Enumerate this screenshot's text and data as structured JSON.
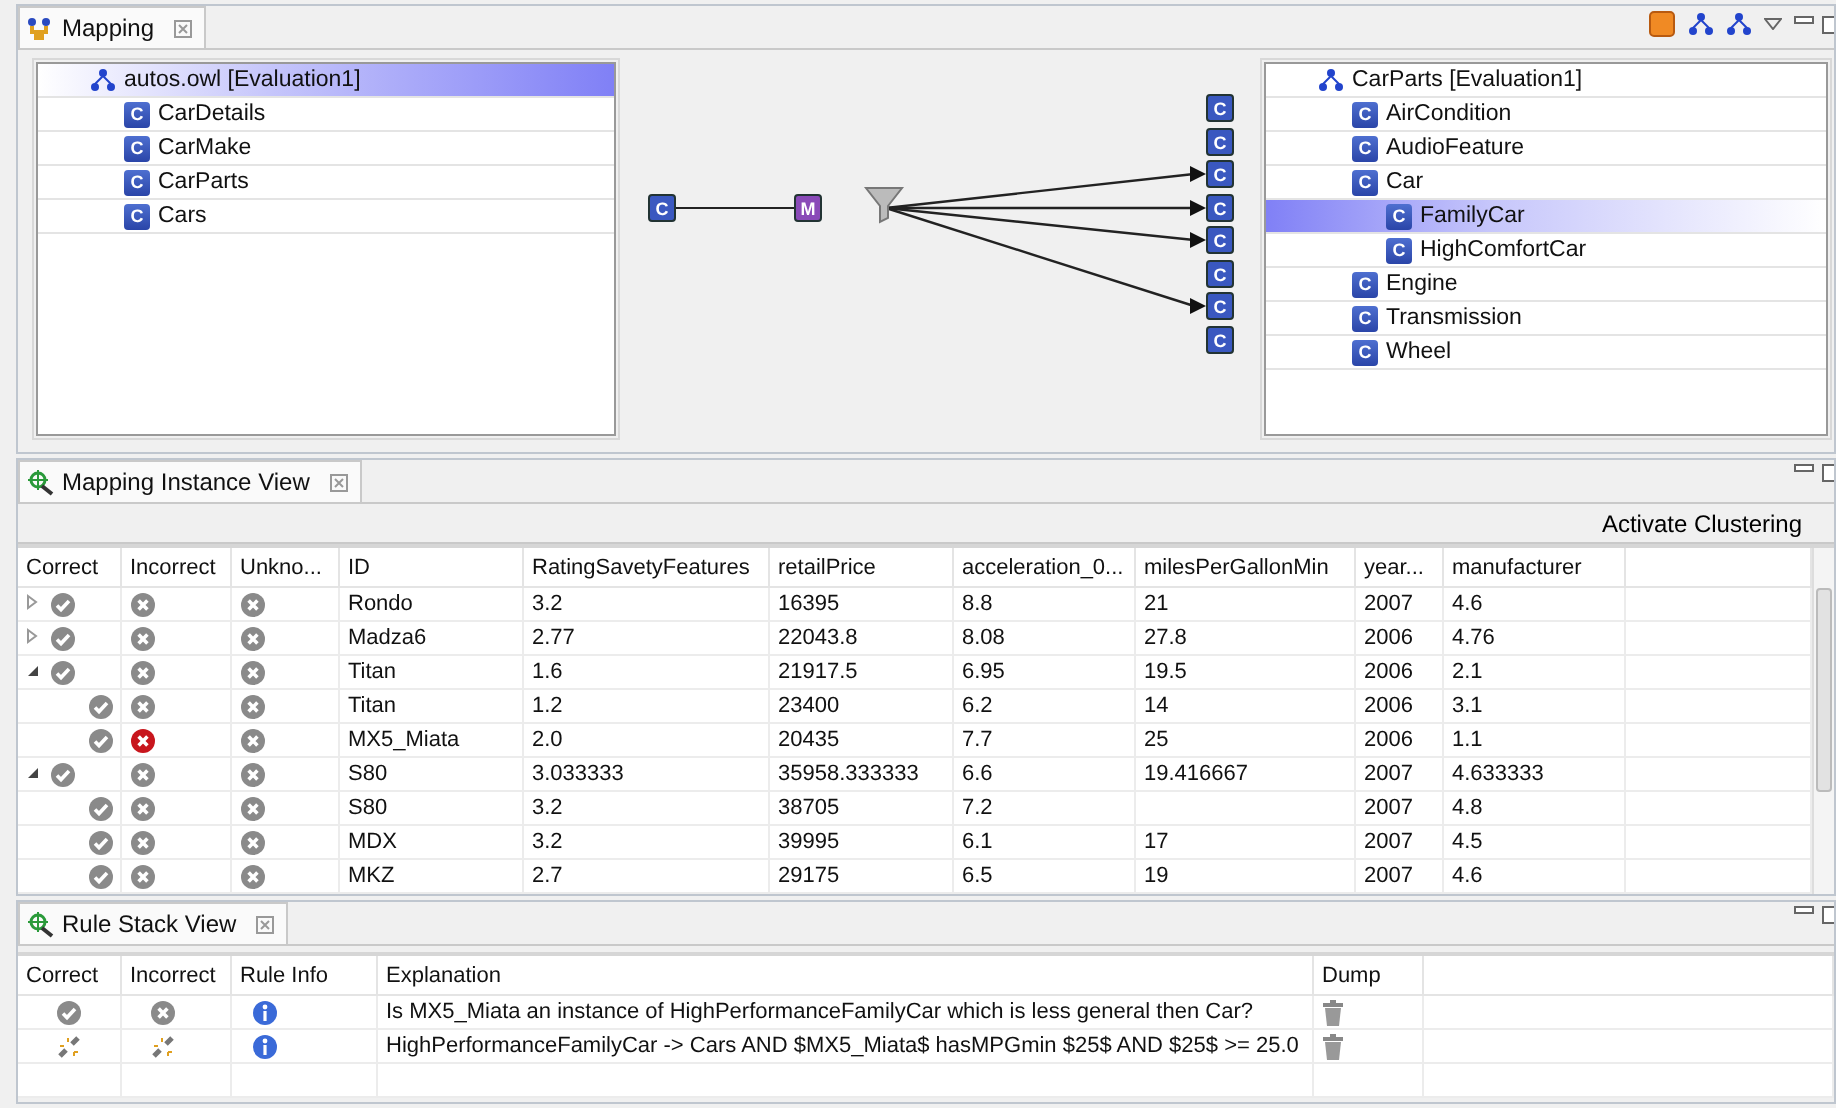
{
  "mapping": {
    "tab": "Mapping",
    "source_tree": {
      "label": "autos.owl [Evaluation1]",
      "kind": "ontology",
      "selected": true,
      "children": [
        {
          "label": "CarDetails",
          "kind": "class",
          "icon_letter": "C",
          "selected": false
        },
        {
          "label": "CarMake",
          "kind": "class",
          "icon_letter": "C",
          "selected": false
        },
        {
          "label": "CarParts",
          "kind": "class",
          "icon_letter": "C",
          "selected": false
        },
        {
          "label": "Cars",
          "kind": "class",
          "icon_letter": "C",
          "selected": false
        }
      ]
    },
    "diagram": {
      "source_node": {
        "label": "C"
      },
      "mapping_node": {
        "label": "M"
      },
      "target_nodes": [
        {
          "label": "C",
          "connected": false
        },
        {
          "label": "C",
          "connected": false
        },
        {
          "label": "C",
          "connected": true
        },
        {
          "label": "C",
          "connected": true
        },
        {
          "label": "C",
          "connected": true
        },
        {
          "label": "C",
          "connected": false
        },
        {
          "label": "C",
          "connected": true
        },
        {
          "label": "C",
          "connected": false
        }
      ]
    },
    "target_tree": {
      "label": "CarParts [Evaluation1]",
      "kind": "ontology",
      "selected": false,
      "children": [
        {
          "label": "AirCondition",
          "kind": "class",
          "icon_letter": "C",
          "selected": false
        },
        {
          "label": "AudioFeature",
          "kind": "class",
          "icon_letter": "C",
          "selected": false
        },
        {
          "label": "Car",
          "kind": "class",
          "icon_letter": "C",
          "selected": false,
          "children": [
            {
              "label": "FamilyCar",
              "kind": "class",
              "icon_letter": "C",
              "selected": true
            },
            {
              "label": "HighComfortCar",
              "kind": "class",
              "icon_letter": "C",
              "selected": false
            }
          ]
        },
        {
          "label": "Engine",
          "kind": "class",
          "icon_letter": "C",
          "selected": false
        },
        {
          "label": "Transmission",
          "kind": "class",
          "icon_letter": "C",
          "selected": false
        },
        {
          "label": "Wheel",
          "kind": "class",
          "icon_letter": "C",
          "selected": false
        }
      ]
    }
  },
  "instance_view": {
    "tab": "Mapping Instance View",
    "toolbar_button": "Activate Clustering",
    "state_columns": [
      "Correct",
      "Incorrect",
      "Unkno..."
    ],
    "columns": [
      "ID",
      "RatingSavetyFeatures",
      "retailPrice",
      "acceleration_0...",
      "milesPerGallonMin",
      "year...",
      "manufacturer"
    ],
    "rows": [
      {
        "expanded": false,
        "incorrect": false,
        "cells": [
          "Rondo",
          "3.2",
          "16395",
          "8.8",
          "21",
          "2007",
          "4.6"
        ]
      },
      {
        "expanded": false,
        "incorrect": false,
        "cells": [
          "Madza6",
          "2.77",
          "22043.8",
          "8.08",
          "27.8",
          "2006",
          "4.76"
        ]
      },
      {
        "expanded": true,
        "incorrect": false,
        "cells": [
          "Titan",
          "1.6",
          "21917.5",
          "6.95",
          "19.5",
          "2006",
          "2.1"
        ],
        "children": [
          {
            "incorrect": false,
            "cells": [
              "Titan",
              "1.2",
              "23400",
              "6.2",
              "14",
              "2006",
              "3.1"
            ]
          },
          {
            "incorrect": true,
            "cells": [
              "MX5_Miata",
              "2.0",
              "20435",
              "7.7",
              "25",
              "2006",
              "1.1"
            ]
          }
        ]
      },
      {
        "expanded": true,
        "incorrect": false,
        "cells": [
          "S80",
          "3.033333",
          "35958.333333",
          "6.6",
          "19.416667",
          "2007",
          "4.633333"
        ],
        "children": [
          {
            "incorrect": false,
            "cells": [
              "S80",
              "3.2",
              "38705",
              "7.2",
              null,
              "2007",
              "4.8"
            ]
          },
          {
            "incorrect": false,
            "cells": [
              "MDX",
              "3.2",
              "39995",
              "6.1",
              "17",
              "2007",
              "4.5"
            ]
          },
          {
            "incorrect": false,
            "cells": [
              "MKZ",
              "2.7",
              "29175",
              "6.5",
              "19",
              "2007",
              "4.6"
            ]
          }
        ]
      }
    ]
  },
  "rule_stack": {
    "tab": "Rule Stack View",
    "columns": [
      "Correct",
      "Incorrect",
      "Rule Info",
      "Explanation",
      "Dump"
    ],
    "rows": [
      {
        "kind": "question",
        "explanation": "Is MX5_Miata an instance of HighPerformanceFamilyCar which is less general then Car?"
      },
      {
        "kind": "rule",
        "explanation": "HighPerformanceFamilyCar -> Cars AND $MX5_Miata$ hasMPGmin $25$ AND $25$ >= 25.0"
      }
    ]
  }
}
